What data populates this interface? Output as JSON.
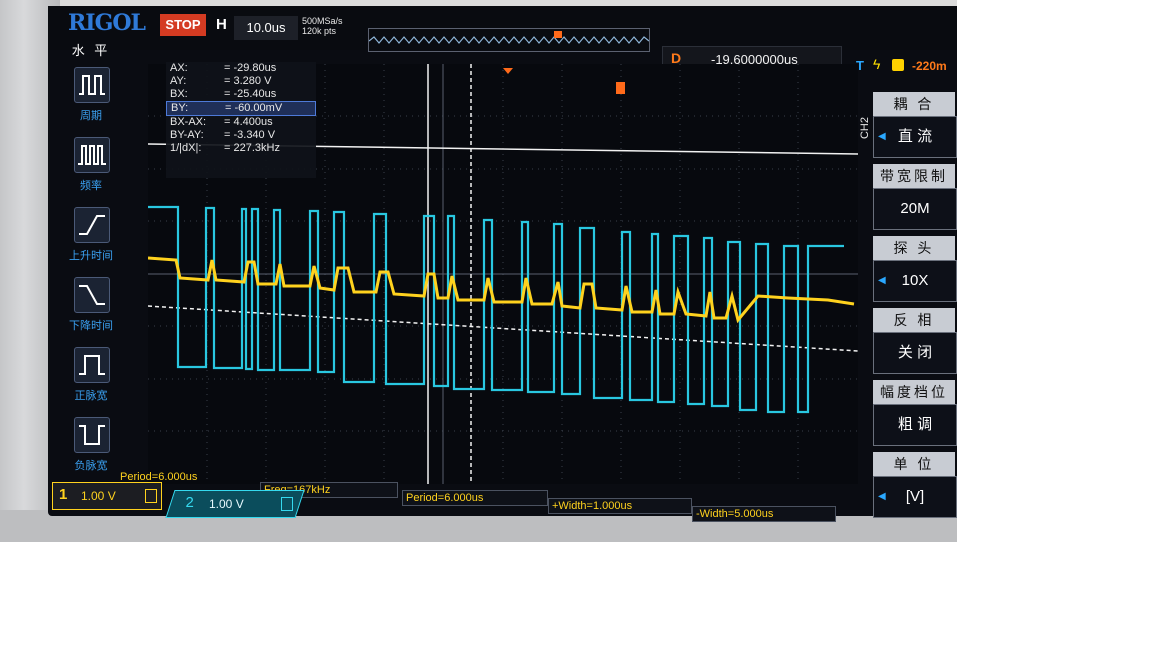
{
  "instrument": {
    "brand": "RIGOL",
    "run_state": "STOP",
    "h_label": "H",
    "timebase": "10.0us",
    "sample_rate": "500MSa/s",
    "memory_depth": "120k pts",
    "trigger_marker": "T",
    "delay_label": "D",
    "delay_value": "-19.6000000us",
    "trigger_label": "T",
    "trigger_edge": "ϟ",
    "trigger_level": "-220m"
  },
  "left_menu": {
    "title": "水 平",
    "items": [
      {
        "label": "周期"
      },
      {
        "label": "频率"
      },
      {
        "label": "上升时间"
      },
      {
        "label": "下降时间"
      },
      {
        "label": "正脉宽"
      },
      {
        "label": "负脉宽"
      }
    ]
  },
  "cursor_readout": [
    {
      "key": "AX:",
      "value": "= -29.80us"
    },
    {
      "key": "AY:",
      "value": "= 3.280 V"
    },
    {
      "key": "BX:",
      "value": "= -25.40us"
    },
    {
      "key": "BY:",
      "value": "= -60.00mV"
    },
    {
      "key": "BX-AX:",
      "value": "= 4.400us"
    },
    {
      "key": "BY-AY:",
      "value": "= -3.340 V"
    },
    {
      "key": "1/|dX|:",
      "value": "= 227.3kHz"
    }
  ],
  "right_panel": {
    "channel_tag": "CH2",
    "coupling_title": "耦 合",
    "coupling_value": "直 流",
    "bw_title": "带宽限制",
    "bw_value": "20M",
    "probe_title": "探 头",
    "probe_value": "10X",
    "invert_title": "反 相",
    "invert_value": "关 闭",
    "vscale_title": "幅度档位",
    "vscale_value": "粗 调",
    "unit_title": "单 位",
    "unit_value": "[V]"
  },
  "measurements": {
    "period_1": "Period=6.000us",
    "freq": "Freq=167kHz",
    "period_2": "Period=6.000us",
    "pos_width": "+Width=1.000us",
    "neg_width": "-Width=5.000us"
  },
  "channels": {
    "ch1_num": "1",
    "ch1_scale": "1.00 V",
    "ch2_num": "2",
    "ch2_scale": "1.00 V"
  },
  "colors": {
    "ch1": "#ffd21e",
    "ch2": "#29c7e0",
    "trigger": "#ff6a1a",
    "accent": "#2f7ad8"
  }
}
